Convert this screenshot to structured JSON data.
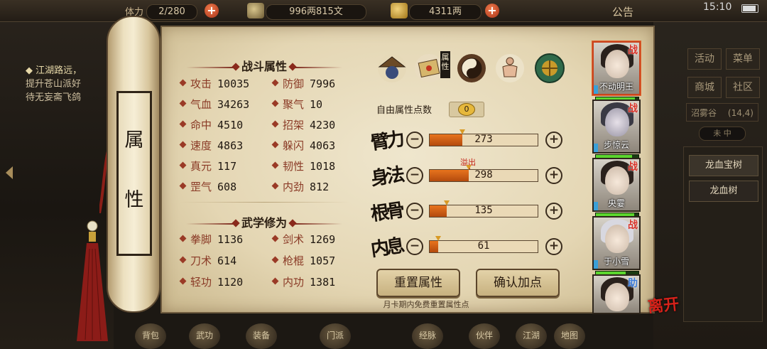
{
  "topbar": {
    "stamina": "2/280",
    "stamina_label": "体力",
    "silver": "996两815文",
    "gold": "4311两",
    "notice": "公告",
    "time": "15:10"
  },
  "quest": {
    "title": "江湖路远，",
    "line2": "提升苍山派好",
    "line3": "待无妄斋飞鸽"
  },
  "scroll_title": [
    "属",
    "性"
  ],
  "battle": {
    "header": "战斗属性",
    "stats": [
      {
        "name": "攻击",
        "value": "10035"
      },
      {
        "name": "防御",
        "value": "7996"
      },
      {
        "name": "气血",
        "value": "34263"
      },
      {
        "name": "聚气",
        "value": "10"
      },
      {
        "name": "命中",
        "value": "4510"
      },
      {
        "name": "招架",
        "value": "4230"
      },
      {
        "name": "速度",
        "value": "4863"
      },
      {
        "name": "躲闪",
        "value": "4063"
      },
      {
        "name": "真元",
        "value": "117"
      },
      {
        "name": "韧性",
        "value": "1018"
      },
      {
        "name": "罡气",
        "value": "608"
      },
      {
        "name": "内劲",
        "value": "812"
      }
    ]
  },
  "martial": {
    "header": "武学修为",
    "stats": [
      {
        "name": "拳脚",
        "value": "1136"
      },
      {
        "name": "剑术",
        "value": "1269"
      },
      {
        "name": "刀术",
        "value": "614"
      },
      {
        "name": "枪棍",
        "value": "1057"
      },
      {
        "name": "轻功",
        "value": "1120"
      },
      {
        "name": "内功",
        "value": "1381"
      }
    ]
  },
  "attr_tab_label": "属性",
  "free_points": {
    "label": "自由属性点数",
    "value": "0"
  },
  "attributes": [
    {
      "label": "臂力",
      "value": "273",
      "fill": 0.3
    },
    {
      "label": "身法",
      "value": "298",
      "fill": 0.36,
      "overflow": "溢出"
    },
    {
      "label": "根骨",
      "value": "135",
      "fill": 0.16
    },
    {
      "label": "内息",
      "value": "61",
      "fill": 0.08
    }
  ],
  "buttons": {
    "reset": "重置属性",
    "confirm": "确认加点",
    "footnote": "月卡期内免费重置属性点"
  },
  "characters": [
    {
      "name": "不动明王",
      "tag": "战",
      "hp": 0.92
    },
    {
      "name": "步惊云",
      "tag": "战",
      "hp": 0.85
    },
    {
      "name": "央霎",
      "tag": "战",
      "hp": 0.9
    },
    {
      "name": "于小雪",
      "tag": "战",
      "hp": 0.7
    },
    {
      "name": "",
      "tag": "助",
      "hp": 0.0
    }
  ],
  "leave": "离开",
  "right_menu": {
    "activity": "活动",
    "menu": "菜单",
    "shop": "商城",
    "community": "社区",
    "location": "沼雾谷",
    "coords": "(14,4)",
    "toggle": "未 中",
    "tree1": "龙血宝树",
    "tree2": "龙血树"
  },
  "bottom_nav": [
    "背包",
    "武功",
    "装备",
    "门派",
    "经脉",
    "伙伴",
    "江湖",
    "地图"
  ],
  "colors": {
    "accent_red": "#9a3a26",
    "bar_orange": "#e8741e",
    "paper": "#ebe0c3"
  }
}
